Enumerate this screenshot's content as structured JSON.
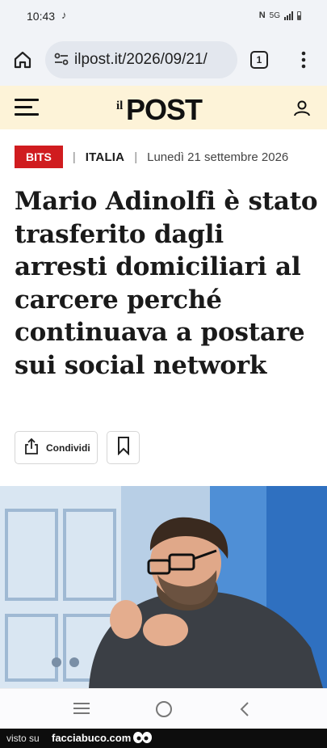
{
  "status_bar": {
    "time": "10:43",
    "music_icon": "music-note-icon",
    "network": "5G",
    "icons": [
      "nfc-icon",
      "signal-icon",
      "battery-icon"
    ]
  },
  "browser": {
    "url": "ilpost.it/2026/09/21/",
    "tab_count": "1",
    "icons": [
      "home-icon",
      "site-settings-icon",
      "tabs-icon",
      "more-menu-icon"
    ]
  },
  "site_header": {
    "logo_prefix": "il",
    "logo_main": "POST",
    "icons": [
      "menu-icon",
      "user-icon"
    ]
  },
  "article": {
    "section_badge": "BITS",
    "category": "ITALIA",
    "date": "Lunedì 21 settembre 2026",
    "headline": "Mario Adinolfi è stato trasferito dagli arresti domiciliari al carcere perché continuava a postare sui social network",
    "share_label": "Condividi",
    "icons": [
      "share-icon",
      "bookmark-icon"
    ]
  },
  "colors": {
    "badge_red": "#d01c1f",
    "site_header_bg": "#fdf3d8",
    "browser_bg": "#f1f3f7"
  },
  "nav_bar": {
    "icons": [
      "recent-apps-icon",
      "home-circle-icon",
      "back-icon"
    ]
  },
  "watermark": {
    "prefix": "visto su",
    "site": "facciabuco.com"
  }
}
